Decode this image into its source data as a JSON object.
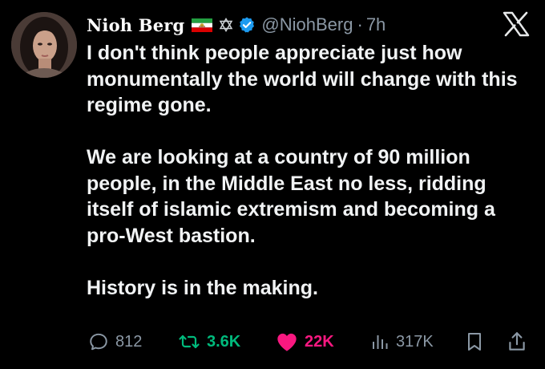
{
  "tweet": {
    "author": {
      "name": "Nioh Berg",
      "handle": "@NiohBerg",
      "separator": "·",
      "time": "7h",
      "badges": [
        "iran-lion-and-sun-flag-icon",
        "star-of-david-icon",
        "verified-badge-icon"
      ]
    },
    "platform_icon": "x-logo-icon",
    "text": {
      "paragraph_1": "I don't think people appreciate just how monumentally the world will change with this regime gone.",
      "paragraph_2": "We are looking at a country of 90 million people, in the Middle East no less, ridding itself of islamic extremism and becoming a pro-West bastion.",
      "paragraph_3": "History is in the making."
    },
    "actions": {
      "replies": "812",
      "reposts": "3.6K",
      "likes": "22K",
      "views": "317K"
    },
    "colors": {
      "background": "#000000",
      "text": "#e7e9ea",
      "muted": "#8b98a5",
      "repost_active": "#00ba7c",
      "like_active": "#f91880",
      "verified": "#1d9bf0"
    }
  }
}
